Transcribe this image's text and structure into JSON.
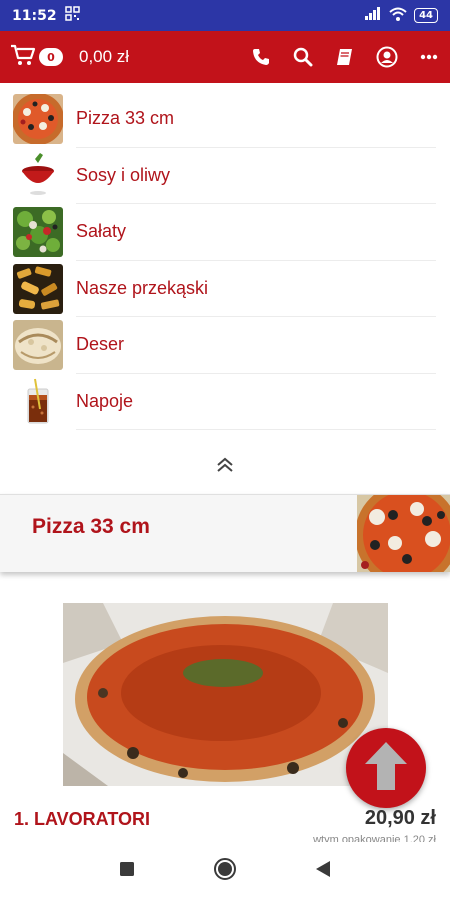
{
  "status_bar": {
    "time": "11:52",
    "battery": "44",
    "icons": [
      "qr-icon",
      "signal-icon",
      "wifi-icon",
      "battery-icon"
    ]
  },
  "app_bar": {
    "cart_count": "0",
    "cart_total": "0,00 zł",
    "actions": [
      "phone-icon",
      "search-icon",
      "book-icon",
      "account-icon",
      "more-icon"
    ],
    "color": "#c2121a"
  },
  "categories": [
    {
      "label": "Pizza 33 cm",
      "thumb": "pizza"
    },
    {
      "label": "Sosy i oliwy",
      "thumb": "sauce"
    },
    {
      "label": "Sałaty",
      "thumb": "salad"
    },
    {
      "label": "Nasze przekąski",
      "thumb": "snack"
    },
    {
      "label": "Deser",
      "thumb": "dessert"
    },
    {
      "label": "Napoje",
      "thumb": "drink"
    }
  ],
  "section": {
    "title": "Pizza 33 cm"
  },
  "product": {
    "name": "1. LAVORATORI",
    "price": "20,90 zł",
    "note": "wtym opakowanie 1,20 zł"
  },
  "nav": [
    "recent-apps-icon",
    "home-icon",
    "back-icon"
  ]
}
